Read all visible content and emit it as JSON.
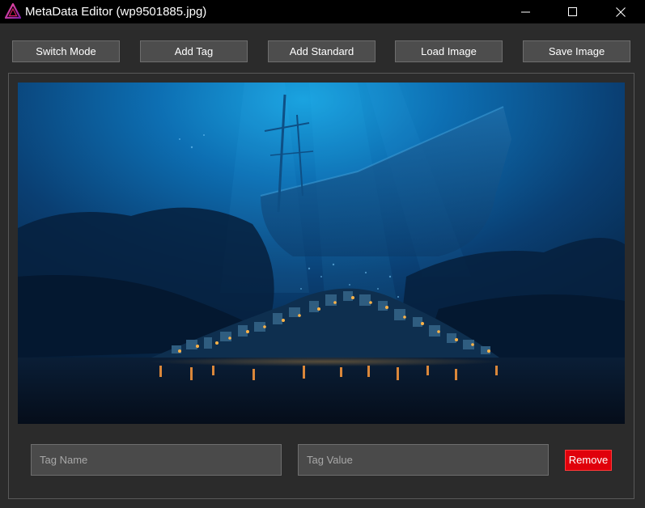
{
  "window": {
    "title": "MetaData Editor (wp9501885.jpg)",
    "app_icon": "triangle-logo-icon",
    "controls": [
      "minimize-icon",
      "maximize-icon",
      "close-icon"
    ]
  },
  "toolbar": {
    "switch_mode_label": "Switch Mode",
    "add_tag_label": "Add Tag",
    "add_standard_label": "Add Standard",
    "load_image_label": "Load Image",
    "save_image_label": "Save Image"
  },
  "tag_editor": {
    "name_value": "",
    "name_placeholder": "Tag Name",
    "value_value": "",
    "value_placeholder": "Tag Value",
    "remove_label": "Remove"
  },
  "colors": {
    "background": "#2b2b2b",
    "titlebar": "#000000",
    "button": "#4d4d4d",
    "remove_button": "#e0000b",
    "logo_accent": "#c2185b"
  }
}
